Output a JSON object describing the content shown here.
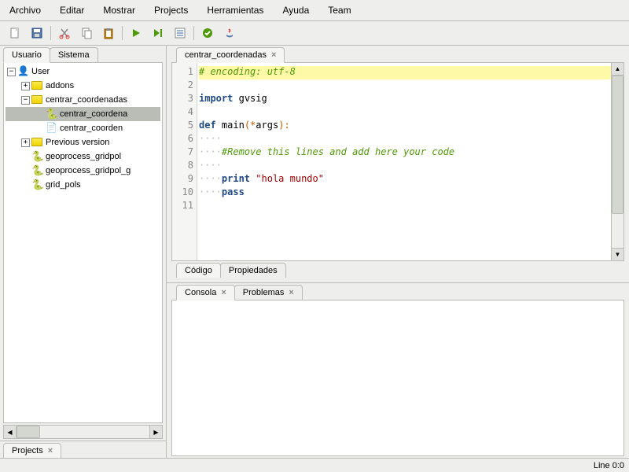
{
  "menubar": [
    "Archivo",
    "Editar",
    "Mostrar",
    "Projects",
    "Herramientas",
    "Ayuda",
    "Team"
  ],
  "left": {
    "tabs": [
      "Usuario",
      "Sistema"
    ],
    "active_tab": 0,
    "tree": {
      "user": "User",
      "addons": "addons",
      "centrar_folder": "centrar_coordenadas",
      "centrar_py": "centrar_coordena",
      "centrar_other": "centrar_coorden",
      "previous": "Previous version",
      "geo1": "geoprocess_gridpol",
      "geo2": "geoprocess_gridpol_g",
      "grid": "grid_pols"
    },
    "bottom_tab": "Projects"
  },
  "editor": {
    "file_tab": "centrar_coordenadas",
    "lines": {
      "1": "# encoding: utf-8",
      "3_import": "import",
      "3_mod": "gvsig",
      "5_def": "def",
      "5_name": "main",
      "5_op1": "(*",
      "5_arg": "args",
      "5_op2": "):",
      "7": "#Remove this lines and add here your code",
      "9_print": "print",
      "9_str": "\"hola mundo\"",
      "10_pass": "pass"
    },
    "bottom_tabs": [
      "Código",
      "Propiedades"
    ],
    "bottom_active": 0
  },
  "console": {
    "tabs": [
      "Consola",
      "Problemas"
    ]
  },
  "status": "Line 0:0",
  "line_numbers": [
    "1",
    "2",
    "3",
    "4",
    "5",
    "6",
    "7",
    "8",
    "9",
    "10",
    "11"
  ]
}
